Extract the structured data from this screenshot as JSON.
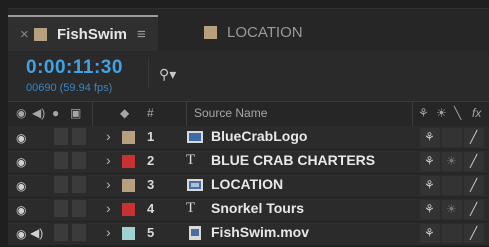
{
  "tabs": [
    {
      "label": "FishSwim",
      "color": "#b6a07e",
      "active": true
    },
    {
      "label": "LOCATION",
      "color": "#b6a07e",
      "active": false
    }
  ],
  "timecode": "0:00:11:30",
  "frames": "00690 (59.94 fps)",
  "search": {
    "placeholder": "",
    "icon": "search-icon"
  },
  "columns": {
    "number": "#",
    "source_name": "Source Name"
  },
  "layers": [
    {
      "index": "1",
      "name": "BlueCrabLogo",
      "type": "image",
      "label_color": "#b6a07e",
      "audio": false
    },
    {
      "index": "2",
      "name": "BLUE CRAB CHARTERS",
      "type": "text",
      "label_color": "#c83232",
      "audio": false
    },
    {
      "index": "3",
      "name": "LOCATION",
      "type": "comp",
      "label_color": "#b6a07e",
      "audio": false
    },
    {
      "index": "4",
      "name": "Snorkel Tours",
      "type": "text",
      "label_color": "#c83232",
      "audio": false
    },
    {
      "index": "5",
      "name": "FishSwim.mov",
      "type": "footage",
      "label_color": "#9ed1cf",
      "audio": true
    }
  ]
}
